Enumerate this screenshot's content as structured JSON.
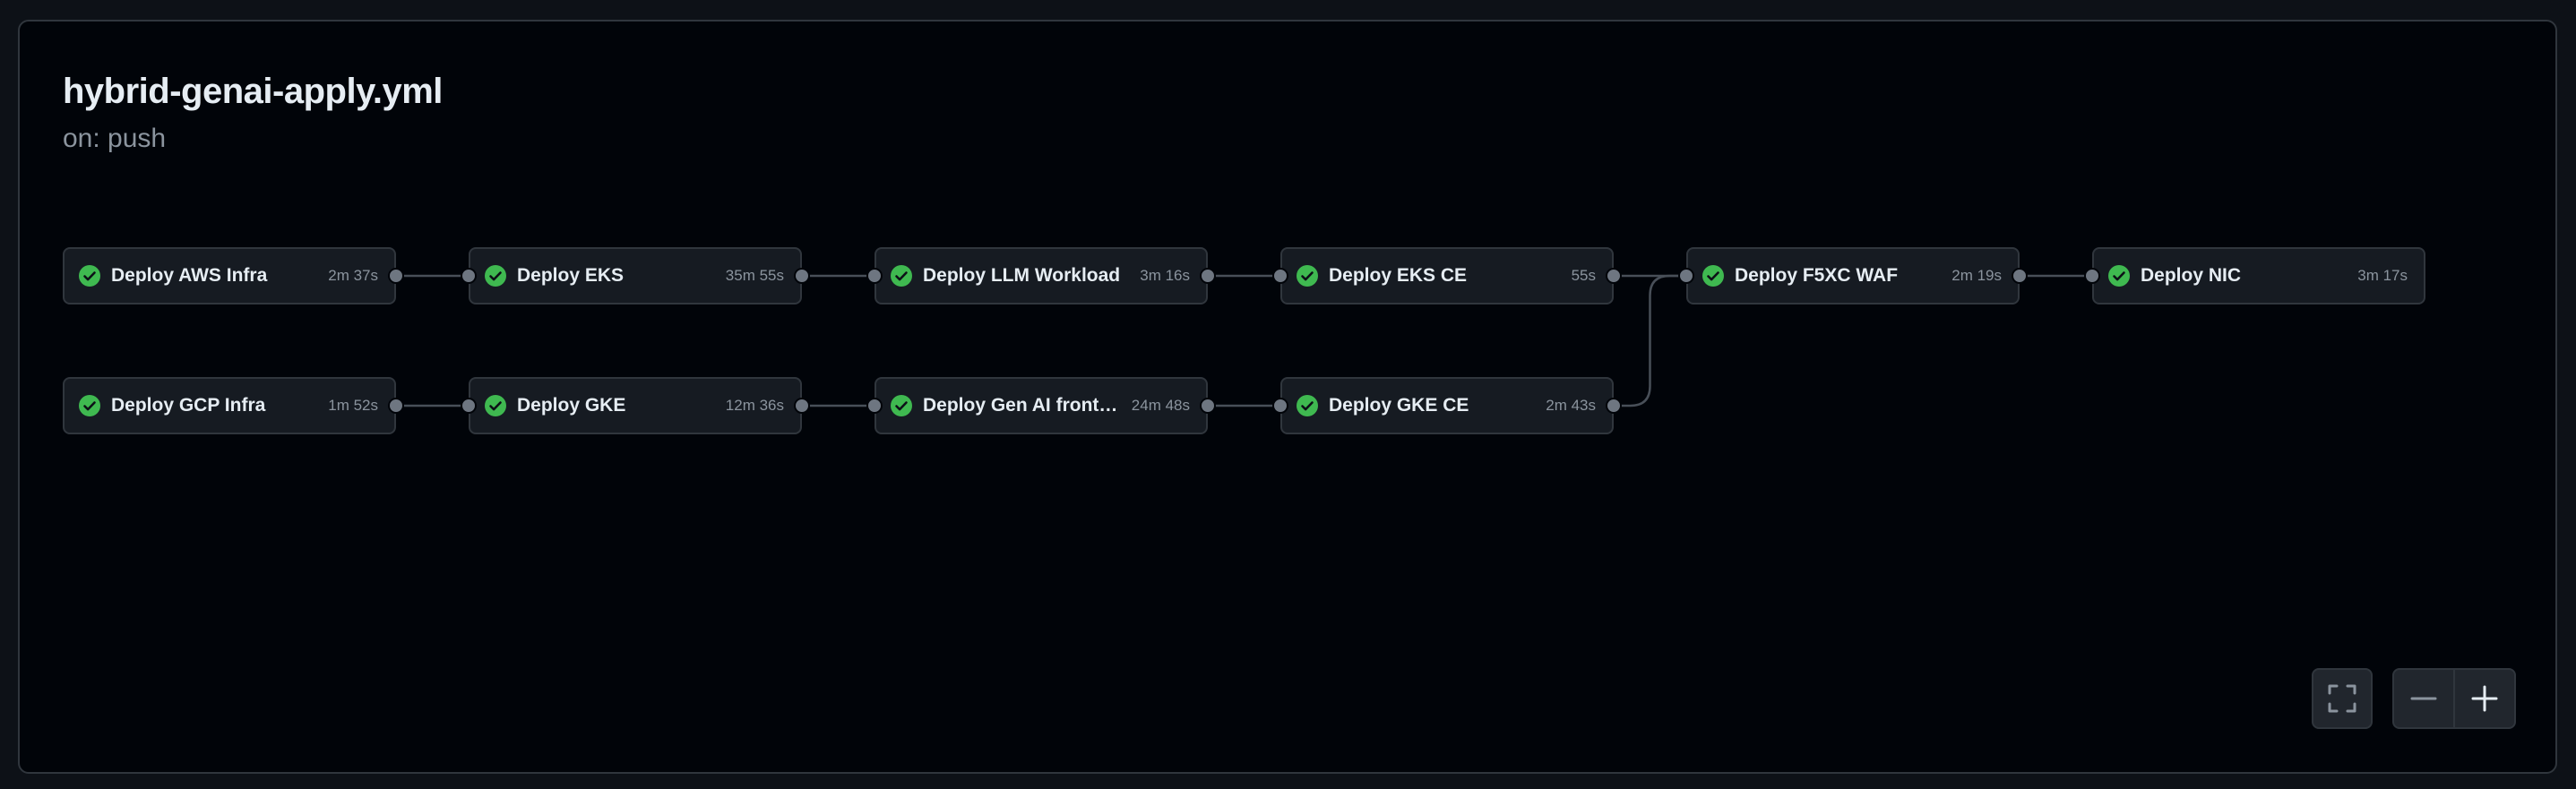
{
  "workflow": {
    "title": "hybrid-genai-apply.yml",
    "trigger": "on: push"
  },
  "jobs": [
    {
      "id": "aws-infra",
      "name": "Deploy AWS Infra",
      "duration": "2m 37s",
      "status": "success"
    },
    {
      "id": "eks",
      "name": "Deploy EKS",
      "duration": "35m 55s",
      "status": "success"
    },
    {
      "id": "llm-workload",
      "name": "Deploy LLM Workload",
      "duration": "3m 16s",
      "status": "success"
    },
    {
      "id": "eks-ce",
      "name": "Deploy EKS CE",
      "duration": "55s",
      "status": "success"
    },
    {
      "id": "f5xc-waf",
      "name": "Deploy F5XC WAF",
      "duration": "2m 19s",
      "status": "success"
    },
    {
      "id": "nic",
      "name": "Deploy NIC",
      "duration": "3m 17s",
      "status": "success"
    },
    {
      "id": "gcp-infra",
      "name": "Deploy GCP Infra",
      "duration": "1m 52s",
      "status": "success"
    },
    {
      "id": "gke",
      "name": "Deploy GKE",
      "duration": "12m 36s",
      "status": "success"
    },
    {
      "id": "genai-frontend",
      "name": "Deploy Gen AI fronten...",
      "duration": "24m 48s",
      "status": "success"
    },
    {
      "id": "gke-ce",
      "name": "Deploy GKE CE",
      "duration": "2m 43s",
      "status": "success"
    }
  ],
  "dependencies": [
    [
      "aws-infra",
      "eks"
    ],
    [
      "eks",
      "llm-workload"
    ],
    [
      "llm-workload",
      "eks-ce"
    ],
    [
      "eks-ce",
      "f5xc-waf"
    ],
    [
      "f5xc-waf",
      "nic"
    ],
    [
      "gcp-infra",
      "gke"
    ],
    [
      "gke",
      "genai-frontend"
    ],
    [
      "genai-frontend",
      "gke-ce"
    ],
    [
      "gke-ce",
      "f5xc-waf"
    ]
  ],
  "controls": {
    "fullscreen_icon": "fullscreen-icon",
    "zoom_out_icon": "minus-icon",
    "zoom_in_icon": "plus-icon"
  },
  "colors": {
    "success": "#3fb950",
    "background": "#010409",
    "card": "#161b22",
    "border": "#30363d"
  }
}
